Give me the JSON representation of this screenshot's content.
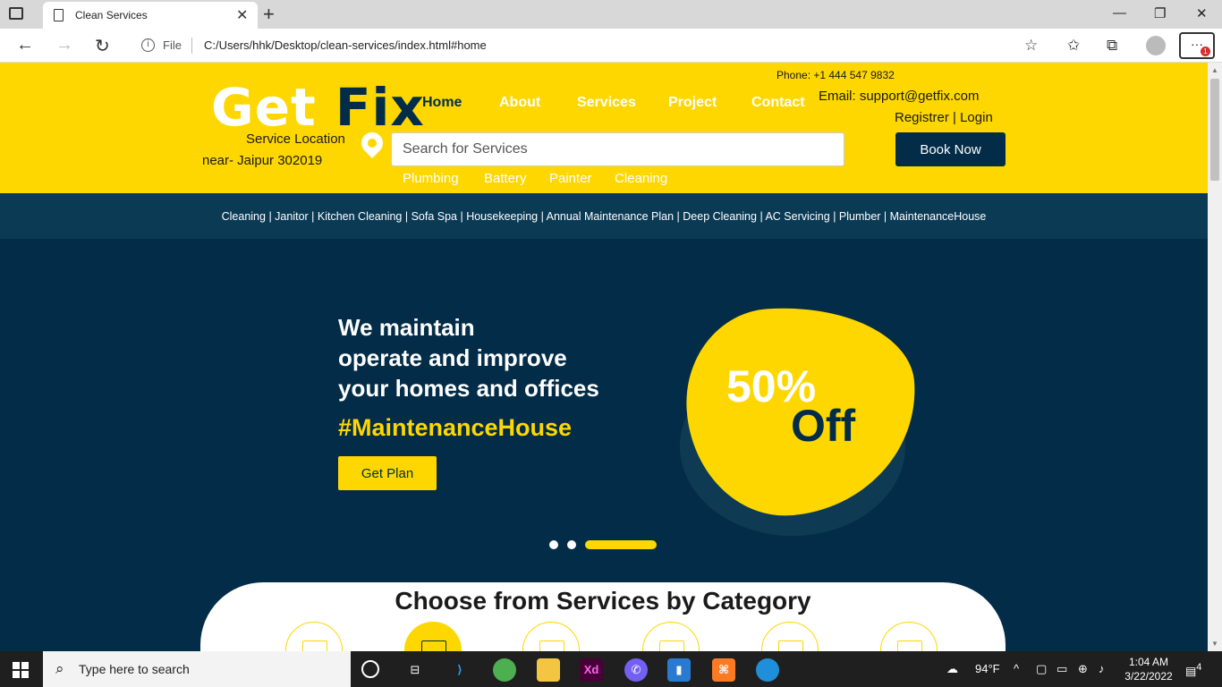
{
  "browser": {
    "tab_title": "Clean Services",
    "address_label": "File",
    "url": "C:/Users/hhk/Desktop/clean-services/index.html#home"
  },
  "header": {
    "logo_get": "Get",
    "logo_fix": "Fix",
    "location_label": "Service Location",
    "location_value": "near- Jaipur 302019",
    "nav": [
      "Home",
      "About",
      "Services",
      "Project",
      "Contact"
    ],
    "phone": "Phone: +1 444 547 9832",
    "email": "Email: support@getfix.com",
    "auth": "Registrer | Login",
    "search_placeholder": "Search for Services",
    "book_label": "Book Now",
    "quick_links": [
      "Plumbing",
      "Battery",
      "Painter",
      "Cleaning"
    ]
  },
  "category_bar": "Cleaning | Janitor | Kitchen Cleaning | Sofa Spa | Housekeeping | Annual Maintenance Plan | Deep Cleaning | AC Servicing | Plumber | MaintenanceHouse",
  "hero": {
    "title_lines": [
      "We maintain",
      "operate and improve",
      "your homes and offices"
    ],
    "hashtag": "#MaintenanceHouse",
    "cta": "Get Plan",
    "offer_pct": "50%",
    "offer_word": "Off"
  },
  "services": {
    "title": "Choose from Services by Category"
  },
  "taskbar": {
    "search_placeholder": "Type here to search",
    "weather": "94°F",
    "time": "1:04 AM",
    "date": "3/22/2022",
    "notification_count": "4"
  },
  "colors": {
    "brand_yellow": "#fed701",
    "brand_navy": "#022c47",
    "category_bar": "#0b3a55"
  }
}
